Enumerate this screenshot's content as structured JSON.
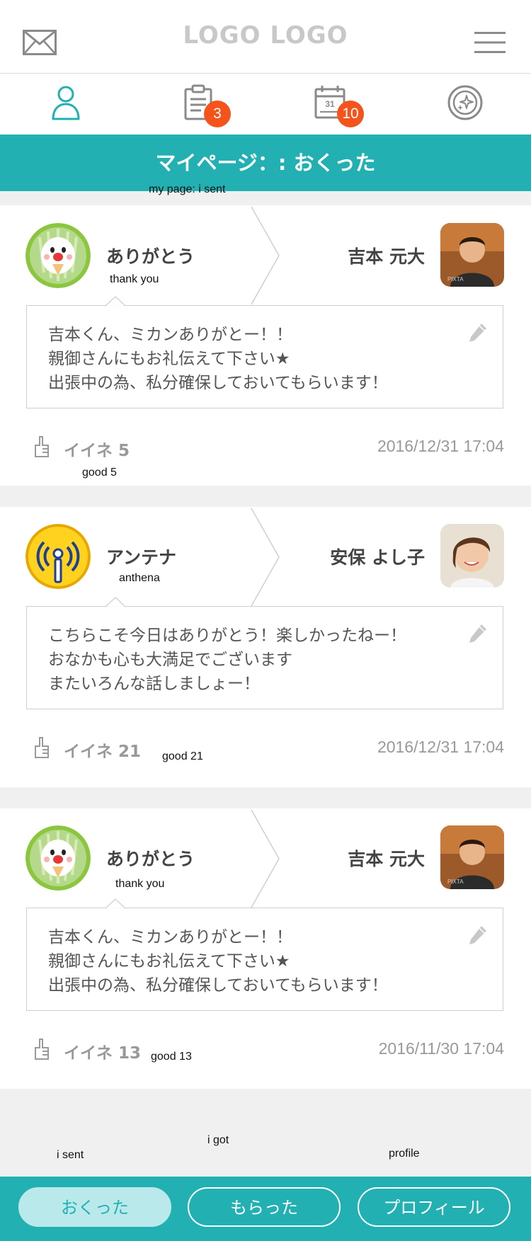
{
  "header": {
    "logo": "LOGO LOGO",
    "mail_icon": "mail-icon",
    "menu_icon": "hamburger-menu-icon"
  },
  "tabs": [
    {
      "icon": "user-icon",
      "active": true
    },
    {
      "icon": "clipboard-icon",
      "badge": "3"
    },
    {
      "icon": "calendar-icon",
      "badge": "10"
    },
    {
      "icon": "sparkle-badge-icon"
    }
  ],
  "page": {
    "title": "マイページ：: おくった",
    "title_annotation": "my page: i sent"
  },
  "posts": [
    {
      "stamp_name": "ありがとう",
      "stamp_annotation": "thank you",
      "stamp_icon": "thank-you-stamp-icon",
      "recipient": "吉本 元大",
      "message": [
        "吉本くん、ミカンありがとー！！",
        "親御さんにもお礼伝えて下さい★",
        "出張中の為、私分確保しておいてもらいます！"
      ],
      "likes_label": "イイネ 5",
      "likes_annotation": "good 5",
      "date": "2016/12/31 17:04"
    },
    {
      "stamp_name": "アンテナ",
      "stamp_annotation": "anthena",
      "stamp_icon": "antenna-stamp-icon",
      "recipient": "安保 よし子",
      "message": [
        "こちらこそ今日はありがとう！楽しかったねー！",
        "おなかも心も大満足でございます",
        "またいろんな話しましょー！"
      ],
      "likes_label": "イイネ 21",
      "likes_annotation": "good 21",
      "date": "2016/12/31 17:04"
    },
    {
      "stamp_name": "ありがとう",
      "stamp_annotation": "thank you",
      "stamp_icon": "thank-you-stamp-icon",
      "recipient": "吉本 元大",
      "message": [
        "吉本くん、ミカンありがとー！！",
        "親御さんにもお礼伝えて下さい★",
        "出張中の為、私分確保しておいてもらいます！"
      ],
      "likes_label": "イイネ 13",
      "likes_annotation": "good 13",
      "date": "2016/11/30 17:04"
    }
  ],
  "bottom_annotations": {
    "sent": "i sent",
    "got": "i got",
    "profile": "profile"
  },
  "bottom_nav": [
    {
      "label": "おくった",
      "active": true
    },
    {
      "label": "もらった",
      "active": false
    },
    {
      "label": "プロフィール",
      "active": false
    }
  ],
  "colors": {
    "accent": "#22b0b2",
    "badge": "#f4531c",
    "active_pill": "#b9e9ea"
  }
}
